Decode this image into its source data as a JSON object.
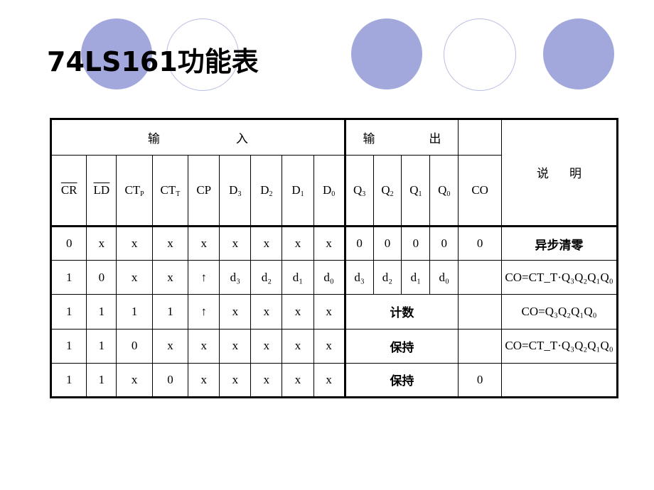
{
  "slide": {
    "title": "74LS161功能表",
    "decor": {
      "filled_color": "#a3a8dc",
      "hollow_border_color": "#b9bde4"
    }
  },
  "table": {
    "group_headers": {
      "inputs": "输　　　入",
      "outputs": "输　　出",
      "note": "说　明"
    },
    "column_headers": {
      "cr": "CR",
      "ld": "LD",
      "ctp": "CT",
      "ctp_sub": "P",
      "ctt": "CT",
      "ctt_sub": "T",
      "cp": "CP",
      "d3": "D",
      "d3_sub": "3",
      "d2": "D",
      "d2_sub": "2",
      "d1": "D",
      "d1_sub": "1",
      "d0": "D",
      "d0_sub": "0",
      "q3": "Q",
      "q3_sub": "3",
      "q2": "Q",
      "q2_sub": "2",
      "q1": "Q",
      "q1_sub": "1",
      "q0": "Q",
      "q0_sub": "0",
      "co": "CO"
    },
    "rows": [
      {
        "cr": "0",
        "ld": "x",
        "ctp": "x",
        "ctt": "x",
        "cp": "x",
        "d3": "x",
        "d2": "x",
        "d1": "x",
        "d0": "x",
        "q3": "0",
        "q2": "0",
        "q1": "0",
        "q0": "0",
        "co": "0",
        "note": "异步清零",
        "note_bold": true
      },
      {
        "cr": "1",
        "ld": "0",
        "ctp": "x",
        "ctt": "x",
        "cp": "↑",
        "d3": "d₃",
        "d2": "d₂",
        "d1": "d₁",
        "d0": "d₀",
        "q3": "d₃",
        "q2": "d₂",
        "q1": "d₁",
        "q0": "d₀",
        "co": "",
        "note": "CO=CT_T·Q₃Q₂Q₁Q₀",
        "note_bold": false
      },
      {
        "cr": "1",
        "ld": "1",
        "ctp": "1",
        "ctt": "1",
        "cp": "↑",
        "d3": "x",
        "d2": "x",
        "d1": "x",
        "d0": "x",
        "out_text": "计数",
        "co": "",
        "note": "CO=Q₃Q₂Q₁Q₀",
        "note_bold": false
      },
      {
        "cr": "1",
        "ld": "1",
        "ctp": "0",
        "ctt": "x",
        "cp": "x",
        "d3": "x",
        "d2": "x",
        "d1": "x",
        "d0": "x",
        "out_text": "保持",
        "co": "",
        "note": "CO=CT_T·Q₃Q₂Q₁Q₀",
        "note_bold": false
      },
      {
        "cr": "1",
        "ld": "1",
        "ctp": "x",
        "ctt": "0",
        "cp": "x",
        "d3": "x",
        "d2": "x",
        "d1": "x",
        "d0": "x",
        "out_text": "保持",
        "co": "0",
        "note": "",
        "note_bold": false
      }
    ],
    "notes_text": {
      "row1": "异步清零",
      "row2_prefix": "CO=CT",
      "row2_sub": "T",
      "row2_rest": "Q",
      "row3_prefix": "CO=Q"
    }
  }
}
